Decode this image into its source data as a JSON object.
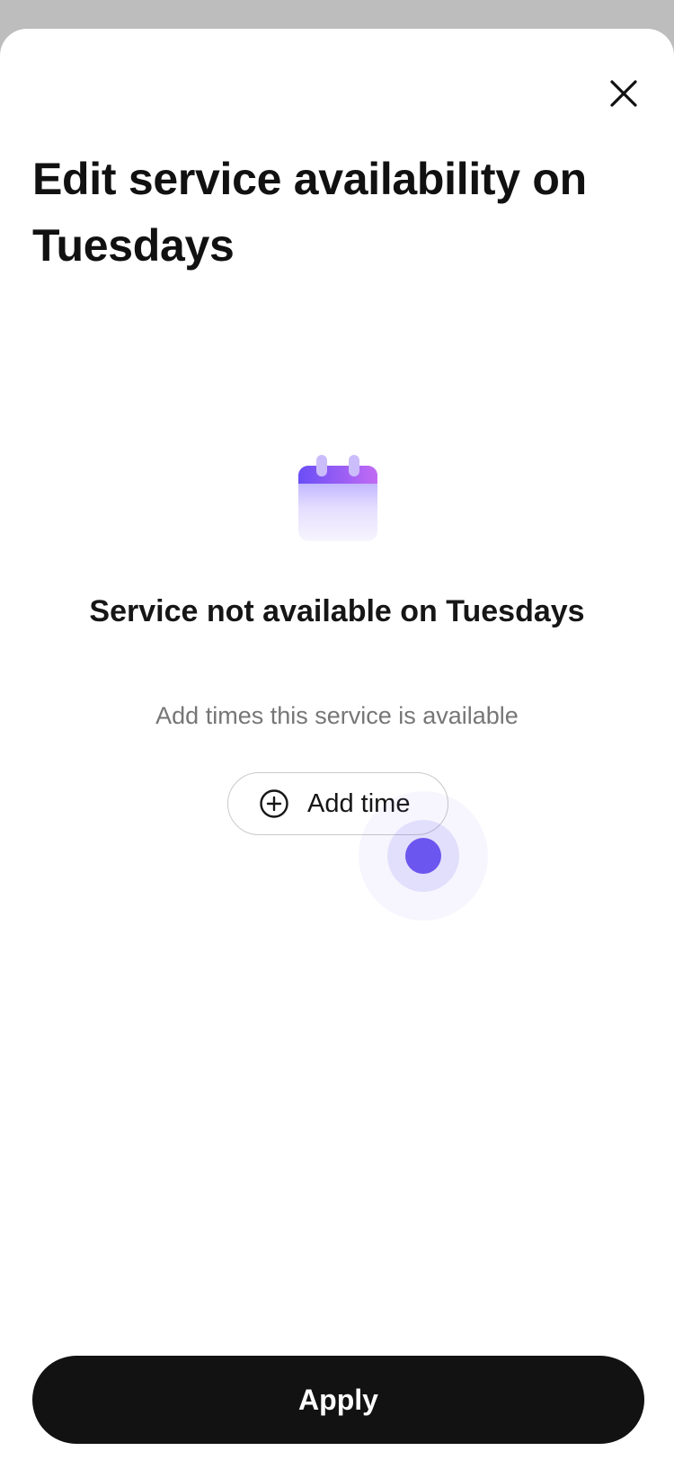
{
  "sheet": {
    "title": "Edit service availability on Tuesdays",
    "close_icon": "close-icon"
  },
  "empty_state": {
    "icon": "calendar-icon",
    "title": "Service not available on Tuesdays",
    "subtitle": "Add times this service is available"
  },
  "add_time": {
    "icon": "plus-circle-icon",
    "label": "Add time"
  },
  "apply": {
    "label": "Apply"
  },
  "colors": {
    "accent": "#6b56ef",
    "button_dark": "#121212",
    "text_primary": "#111111",
    "text_secondary": "#767676"
  }
}
